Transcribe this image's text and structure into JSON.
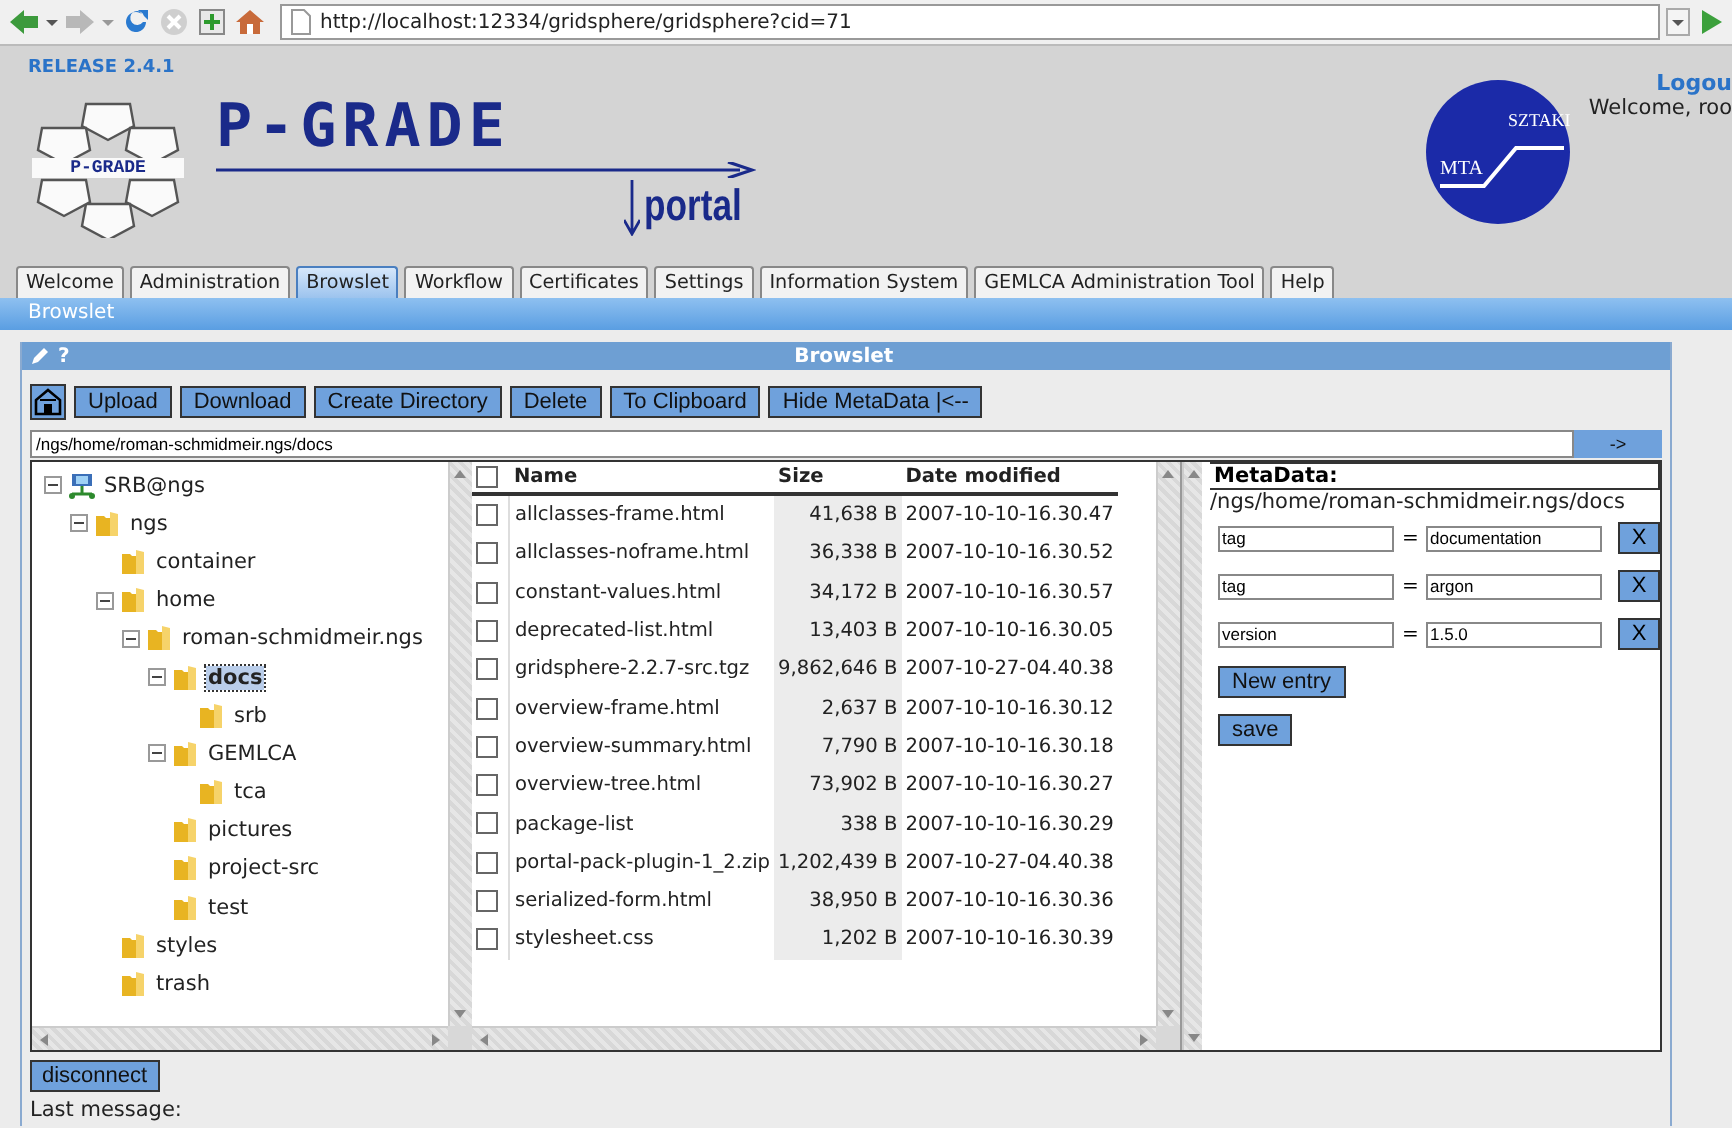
{
  "browser": {
    "url": "http://localhost:12334/gridsphere/gridsphere?cid=71"
  },
  "header": {
    "release": "RELEASE 2.4.1",
    "logo_small": "P-GRADE",
    "logo_title": "P-GRADE",
    "logo_subtitle": "portal",
    "partner_logo": [
      "MTA",
      "SZTAKI"
    ],
    "logout": "Logou",
    "welcome": "Welcome, roo"
  },
  "tabs": [
    {
      "label": "Welcome",
      "selected": false
    },
    {
      "label": "Administration",
      "selected": false
    },
    {
      "label": "Browslet",
      "selected": true
    },
    {
      "label": "Workflow",
      "selected": false
    },
    {
      "label": "Certificates",
      "selected": false
    },
    {
      "label": "Settings",
      "selected": false
    },
    {
      "label": "Information System",
      "selected": false
    },
    {
      "label": "GEMLCA Administration Tool",
      "selected": false
    },
    {
      "label": "Help",
      "selected": false
    }
  ],
  "breadcrumb": "Browslet",
  "panel": {
    "title": "Browslet",
    "help": "?"
  },
  "toolbar": {
    "buttons": [
      "Upload",
      "Download",
      "Create Directory",
      "Delete",
      "To Clipboard",
      "Hide MetaData |<--"
    ]
  },
  "path": {
    "value": "/ngs/home/roman-schmidmeir.ngs/docs",
    "go": "->"
  },
  "tree": [
    {
      "label": "SRB@ngs",
      "kind": "server",
      "expanded": true,
      "selected": false,
      "children": [
        {
          "label": "ngs",
          "kind": "folder",
          "expanded": true,
          "selected": false,
          "children": [
            {
              "label": "container",
              "kind": "folder",
              "selected": false
            },
            {
              "label": "home",
              "kind": "folder",
              "expanded": true,
              "selected": false,
              "children": [
                {
                  "label": "roman-schmidmeir.ngs",
                  "kind": "folder",
                  "expanded": true,
                  "selected": false,
                  "children": [
                    {
                      "label": "docs",
                      "kind": "folder",
                      "expanded": true,
                      "selected": true,
                      "children": [
                        {
                          "label": "srb",
                          "kind": "folder",
                          "selected": false
                        }
                      ]
                    },
                    {
                      "label": "GEMLCA",
                      "kind": "folder",
                      "expanded": true,
                      "selected": false,
                      "children": [
                        {
                          "label": "tca",
                          "kind": "folder",
                          "selected": false
                        }
                      ]
                    },
                    {
                      "label": "pictures",
                      "kind": "folder",
                      "selected": false
                    },
                    {
                      "label": "project-src",
                      "kind": "folder",
                      "selected": false
                    },
                    {
                      "label": "test",
                      "kind": "folder",
                      "selected": false
                    }
                  ]
                }
              ]
            },
            {
              "label": "styles",
              "kind": "folder",
              "selected": false
            },
            {
              "label": "trash",
              "kind": "folder",
              "selected": false
            }
          ]
        }
      ]
    }
  ],
  "files": {
    "columns": [
      "Name",
      "Size",
      "Date modified"
    ],
    "all_checked": false,
    "rows": [
      {
        "name": "allclasses-frame.html",
        "size": "41,638 B",
        "date": "2007-10-10-16.30.47",
        "checked": false
      },
      {
        "name": "allclasses-noframe.html",
        "size": "36,338 B",
        "date": "2007-10-10-16.30.52",
        "checked": false
      },
      {
        "name": "constant-values.html",
        "size": "34,172 B",
        "date": "2007-10-10-16.30.57",
        "checked": false
      },
      {
        "name": "deprecated-list.html",
        "size": "13,403 B",
        "date": "2007-10-10-16.30.05",
        "checked": false
      },
      {
        "name": "gridsphere-2.2.7-src.tgz",
        "size": "9,862,646 B",
        "date": "2007-10-27-04.40.38",
        "checked": false
      },
      {
        "name": "overview-frame.html",
        "size": "2,637 B",
        "date": "2007-10-10-16.30.12",
        "checked": false
      },
      {
        "name": "overview-summary.html",
        "size": "7,790 B",
        "date": "2007-10-10-16.30.18",
        "checked": false
      },
      {
        "name": "overview-tree.html",
        "size": "73,902 B",
        "date": "2007-10-10-16.30.27",
        "checked": false
      },
      {
        "name": "package-list",
        "size": "338 B",
        "date": "2007-10-10-16.30.29",
        "checked": false
      },
      {
        "name": "portal-pack-plugin-1_2.zip",
        "size": "1,202,439 B",
        "date": "2007-10-27-04.40.38",
        "checked": false
      },
      {
        "name": "serialized-form.html",
        "size": "38,950 B",
        "date": "2007-10-10-16.30.36",
        "checked": false
      },
      {
        "name": "stylesheet.css",
        "size": "1,202 B",
        "date": "2007-10-10-16.30.39",
        "checked": false
      }
    ]
  },
  "metadata": {
    "title": "MetaData:",
    "path": "/ngs/home/roman-schmidmeir.ngs/docs",
    "entries": [
      {
        "key": "tag",
        "equals": "=",
        "value": "documentation",
        "remove": "X"
      },
      {
        "key": "tag",
        "equals": "=",
        "value": "argon",
        "remove": "X"
      },
      {
        "key": "version",
        "equals": "=",
        "value": "1.5.0",
        "remove": "X"
      }
    ],
    "new_entry": "New entry",
    "save": "save"
  },
  "footer": {
    "disconnect": "disconnect",
    "last_message": "Last message:"
  }
}
